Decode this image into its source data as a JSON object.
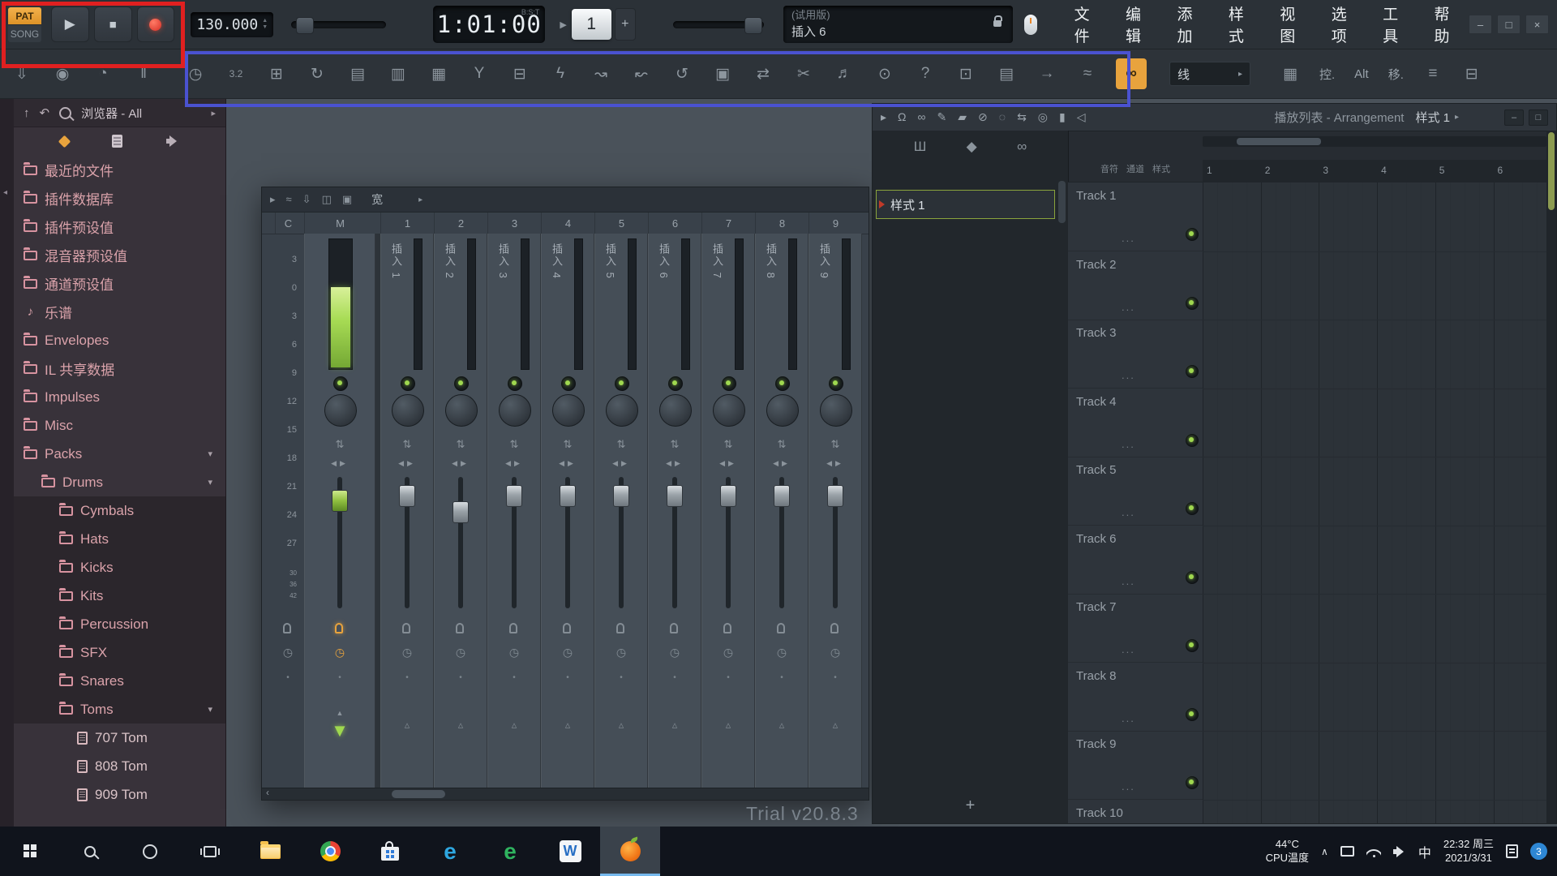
{
  "colors": {
    "accent_orange": "#e8a33d",
    "accent_green": "#9fd84f",
    "browser_pink": "#dba3ab",
    "annotation_red": "#e02020",
    "annotation_blue": "#4a52d0",
    "badge_blue": "#2e87d4"
  },
  "topbar": {
    "pat_label": "PAT",
    "song_label": "SONG",
    "tempo": "130.000",
    "time_value": "1:01:00",
    "time_mode": "B:S:T",
    "pattern_number": "1",
    "pattern_plus": "+",
    "hint_line1": "(试用版)",
    "hint_line2": "插入 6",
    "menu_items": [
      {
        "name": "menu-file",
        "label": "文件"
      },
      {
        "name": "menu-edit",
        "label": "编辑"
      },
      {
        "name": "menu-add",
        "label": "添加"
      },
      {
        "name": "menu-patterns",
        "label": "样式"
      },
      {
        "name": "menu-view",
        "label": "视图"
      },
      {
        "name": "menu-options",
        "label": "选项"
      },
      {
        "name": "menu-tools",
        "label": "工具"
      },
      {
        "name": "menu-help",
        "label": "帮助"
      }
    ],
    "window_buttons": {
      "minimize": "–",
      "maximize": "□",
      "close": "×"
    }
  },
  "toolbar2": {
    "left_icons": [
      {
        "name": "save-project-icon",
        "glyph": "⇩"
      },
      {
        "name": "main-volume-knob-icon",
        "glyph": "◉"
      },
      {
        "name": "main-pitch-knob-icon",
        "glyph": "◔"
      },
      {
        "name": "shuffle-fader-icon",
        "glyph": "‖"
      }
    ],
    "main_icons": [
      {
        "name": "metronome-icon",
        "glyph": "◷"
      },
      {
        "name": "precount-icon",
        "glyph": "3.2"
      },
      {
        "name": "blend-recording-icon",
        "glyph": "⊞"
      },
      {
        "name": "loop-recording-icon",
        "glyph": "↻"
      },
      {
        "name": "step-editing-icon",
        "glyph": "▤"
      },
      {
        "name": "multilink-controllers-icon",
        "glyph": "▥"
      },
      {
        "name": "channel-rack-icon",
        "glyph": "▦"
      },
      {
        "name": "split-channels-icon",
        "glyph": "Y"
      },
      {
        "name": "clone-pattern-icon",
        "glyph": "⊟"
      },
      {
        "name": "plugin-picker-icon",
        "glyph": "ϟ"
      },
      {
        "name": "envelope-icon",
        "glyph": "↝"
      },
      {
        "name": "slide-tool-icon",
        "glyph": "↜"
      },
      {
        "name": "undo-icon",
        "glyph": "↺"
      },
      {
        "name": "save-icon",
        "glyph": "▣"
      },
      {
        "name": "export-icon",
        "glyph": "⇄"
      },
      {
        "name": "cut-icon",
        "glyph": "✂"
      },
      {
        "name": "record-audio-icon",
        "glyph": "♬"
      },
      {
        "name": "hint-bubble-icon",
        "glyph": "⊙"
      },
      {
        "name": "help-icon",
        "glyph": "?"
      },
      {
        "name": "window-layout-icon",
        "glyph": "⊡"
      },
      {
        "name": "piano-roll-icon",
        "glyph": "▤"
      },
      {
        "name": "forward-icon",
        "glyph": "→"
      },
      {
        "name": "wave-editor-icon",
        "glyph": "≈"
      }
    ],
    "link_glyph": "∞",
    "line_tool_label": "线",
    "right_buttons": [
      {
        "name": "typing-keyboard-piano-icon",
        "glyph": "▦"
      },
      {
        "name": "ctrl-button",
        "label": "控."
      },
      {
        "name": "alt-button",
        "label": "Alt"
      },
      {
        "name": "transpose-button",
        "label": "移."
      },
      {
        "name": "tools-menu-icon",
        "glyph": "≡"
      },
      {
        "name": "project-files-icon",
        "glyph": "⊟"
      }
    ]
  },
  "browser": {
    "title": "浏览器 - All",
    "items": [
      {
        "name": "recent-files",
        "label": "最近的文件",
        "indent": 0,
        "kind": "folder",
        "caret": false,
        "dark": false
      },
      {
        "name": "plugin-database",
        "label": "插件数据库",
        "indent": 0,
        "kind": "folder",
        "caret": false,
        "dark": false
      },
      {
        "name": "plugin-presets",
        "label": "插件预设值",
        "indent": 0,
        "kind": "folder",
        "caret": false,
        "dark": false
      },
      {
        "name": "mixer-presets",
        "label": "混音器预设值",
        "indent": 0,
        "kind": "folder",
        "caret": false,
        "dark": false
      },
      {
        "name": "channel-presets",
        "label": "通道预设值",
        "indent": 0,
        "kind": "folder",
        "caret": false,
        "dark": false
      },
      {
        "name": "scores",
        "label": "乐谱",
        "indent": 0,
        "kind": "note",
        "caret": false,
        "dark": false
      },
      {
        "name": "envelopes",
        "label": "Envelopes",
        "indent": 0,
        "kind": "folder",
        "caret": false,
        "dark": false
      },
      {
        "name": "il-shared-data",
        "label": "IL 共享数据",
        "indent": 0,
        "kind": "folder",
        "caret": false,
        "dark": false
      },
      {
        "name": "impulses",
        "label": "Impulses",
        "indent": 0,
        "kind": "folder",
        "caret": false,
        "dark": false
      },
      {
        "name": "misc",
        "label": "Misc",
        "indent": 0,
        "kind": "folder",
        "caret": false,
        "dark": false
      },
      {
        "name": "packs",
        "label": "Packs",
        "indent": 0,
        "kind": "folder",
        "caret": true,
        "dark": false
      },
      {
        "name": "drums",
        "label": "Drums",
        "indent": 1,
        "kind": "folder",
        "caret": true,
        "dark": false
      },
      {
        "name": "cymbals",
        "label": "Cymbals",
        "indent": 2,
        "kind": "folder",
        "caret": false,
        "dark": true
      },
      {
        "name": "hats",
        "label": "Hats",
        "indent": 2,
        "kind": "folder",
        "caret": false,
        "dark": true
      },
      {
        "name": "kicks",
        "label": "Kicks",
        "indent": 2,
        "kind": "folder",
        "caret": false,
        "dark": true
      },
      {
        "name": "kits",
        "label": "Kits",
        "indent": 2,
        "kind": "folder",
        "caret": false,
        "dark": true
      },
      {
        "name": "percussion",
        "label": "Percussion",
        "indent": 2,
        "kind": "folder",
        "caret": false,
        "dark": true
      },
      {
        "name": "sfx",
        "label": "SFX",
        "indent": 2,
        "kind": "folder",
        "caret": false,
        "dark": true
      },
      {
        "name": "snares",
        "label": "Snares",
        "indent": 2,
        "kind": "folder",
        "caret": false,
        "dark": true
      },
      {
        "name": "toms",
        "label": "Toms",
        "indent": 2,
        "kind": "folder",
        "caret": true,
        "dark": true
      },
      {
        "name": "707-tom",
        "label": "707 Tom",
        "indent": 3,
        "kind": "file",
        "caret": false,
        "dark": false
      },
      {
        "name": "808-tom",
        "label": "808 Tom",
        "indent": 3,
        "kind": "file",
        "caret": false,
        "dark": false
      },
      {
        "name": "909-tom",
        "label": "909 Tom",
        "indent": 3,
        "kind": "file",
        "caret": false,
        "dark": false
      }
    ]
  },
  "mixer": {
    "titlebar_icons": [
      {
        "name": "mixer-menu-icon",
        "glyph": "▸"
      },
      {
        "name": "mixer-view-icon",
        "glyph": "≈"
      },
      {
        "name": "mixer-detach-icon",
        "glyph": "⇩"
      },
      {
        "name": "mixer-layout-icon",
        "glyph": "◫"
      },
      {
        "name": "mixer-plugin-icon",
        "glyph": "▣"
      }
    ],
    "width_label": "宽",
    "current_header": "C",
    "master_header": "M",
    "channel_numbers": [
      "1",
      "2",
      "3",
      "4",
      "5",
      "6",
      "7",
      "8",
      "9"
    ],
    "db_scale": [
      "3",
      "0",
      "3",
      "6",
      "9",
      "12",
      "15",
      "18",
      "21",
      "24",
      "27"
    ],
    "db_scale_small": [
      "30",
      "36",
      "42"
    ],
    "master": {
      "fader": 16,
      "meter_level": 0.62
    },
    "channels": [
      {
        "label": "插入 1",
        "fader": 10
      },
      {
        "label": "插入 2",
        "fader": 30
      },
      {
        "label": "插入 3",
        "fader": 10
      },
      {
        "label": "插入 4",
        "fader": 10
      },
      {
        "label": "插入 5",
        "fader": 10
      },
      {
        "label": "插入 6",
        "fader": 10
      },
      {
        "label": "插入 7",
        "fader": 10
      },
      {
        "label": "插入 8",
        "fader": 10
      },
      {
        "label": "插入 9",
        "fader": 10
      }
    ],
    "trial_label": "Trial v20.8.3"
  },
  "picker": {
    "tab_icons": [
      {
        "name": "picker-patterns-icon",
        "glyph": "Ш"
      },
      {
        "name": "picker-audio-icon",
        "glyph": "◆"
      },
      {
        "name": "picker-automation-icon",
        "glyph": "∞"
      }
    ],
    "pattern_name": "样式 1",
    "add_label": "+"
  },
  "playlist": {
    "toolbar_icons": [
      {
        "name": "playlist-menu-icon",
        "glyph": "▸"
      },
      {
        "name": "magnet-icon",
        "glyph": "Ω"
      },
      {
        "name": "link-icon",
        "glyph": "∞"
      },
      {
        "name": "pencil-icon",
        "glyph": "✎"
      },
      {
        "name": "brush-icon",
        "glyph": "▰"
      },
      {
        "name": "delete-icon",
        "glyph": "⊘"
      },
      {
        "name": "mute-icon",
        "glyph": "◌"
      },
      {
        "name": "slip-icon",
        "glyph": "⇆"
      },
      {
        "name": "zoom-icon",
        "glyph": "◎"
      },
      {
        "name": "playback-marker-icon",
        "glyph": "▮"
      },
      {
        "name": "preview-speaker-icon",
        "glyph": "◁"
      }
    ],
    "title": "播放列表 - Arrangement",
    "pattern_label": "样式 1",
    "corner_tabs": [
      "音符",
      "通道",
      "样式"
    ],
    "timeline": [
      "1",
      "2",
      "3",
      "4",
      "5",
      "6"
    ],
    "tracks": [
      "Track 1",
      "Track 2",
      "Track 3",
      "Track 4",
      "Track 5",
      "Track 6",
      "Track 7",
      "Track 8",
      "Track 9",
      "Track 10"
    ],
    "window_buttons": [
      "–",
      "□"
    ]
  },
  "taskbar": {
    "buttons": [
      {
        "name": "start-button",
        "kind": "start"
      },
      {
        "name": "search-button",
        "kind": "search"
      },
      {
        "name": "cortana-button",
        "kind": "cortana"
      },
      {
        "name": "task-view-button",
        "kind": "taskview"
      },
      {
        "name": "explorer-taskbar-icon",
        "kind": "explorer"
      },
      {
        "name": "chrome-taskbar-icon",
        "kind": "chrome"
      },
      {
        "name": "store-taskbar-icon",
        "kind": "store"
      },
      {
        "name": "edge-taskbar-icon",
        "kind": "edge",
        "glyph": "e"
      },
      {
        "name": "ie-taskbar-icon",
        "kind": "ie",
        "glyph": "e"
      },
      {
        "name": "wps-taskbar-icon",
        "kind": "wps",
        "glyph": "W"
      },
      {
        "name": "fl-studio-taskbar-icon",
        "kind": "fl",
        "active": true
      }
    ],
    "tray": {
      "temp_line1": "44°C",
      "temp_line2": "CPU温度",
      "ime": "中",
      "time": "22:32 周三",
      "date": "2021/3/31",
      "badge": "3"
    }
  }
}
